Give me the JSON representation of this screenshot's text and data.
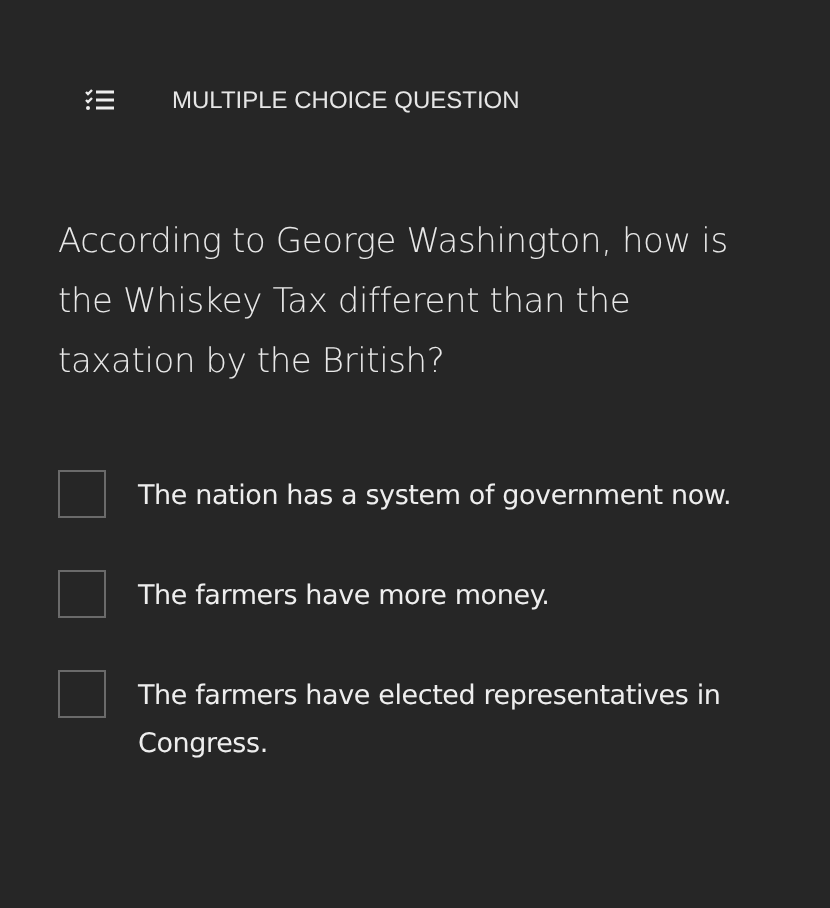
{
  "header": {
    "label": "MULTIPLE CHOICE QUESTION"
  },
  "question": "According to George Washington, how is the Whiskey Tax different than the taxation by the British?",
  "options": [
    {
      "text": "The nation has a system of government now.",
      "checked": false
    },
    {
      "text": "The farmers have more money.",
      "checked": false
    },
    {
      "text": "The farmers have elected representatives in Congress.",
      "checked": false
    }
  ]
}
